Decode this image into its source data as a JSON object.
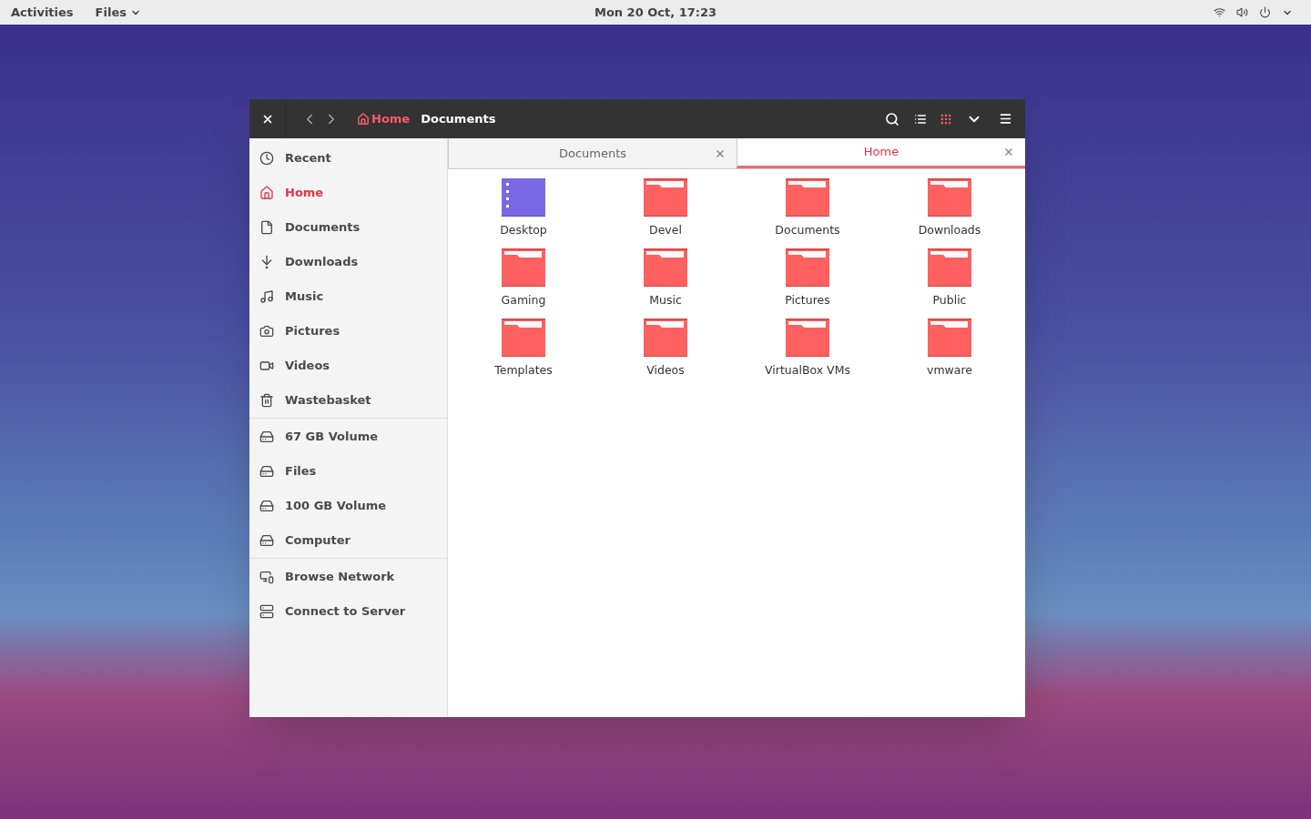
{
  "top_bar": {
    "activities": "Activities",
    "app_menu": "Files",
    "clock": "Mon 20 Oct, 17:23"
  },
  "window": {
    "breadcrumbs": [
      {
        "label": "Home",
        "selected": true,
        "kind": "home"
      },
      {
        "label": "Documents",
        "selected": false,
        "kind": "folder"
      }
    ],
    "views": [
      {
        "kind": "list",
        "selected": false
      },
      {
        "kind": "grid",
        "selected": true
      }
    ]
  },
  "sidebar": {
    "sections": [
      [
        {
          "label": "Recent",
          "selected": false
        },
        {
          "label": "Home",
          "selected": true
        },
        {
          "label": "Documents",
          "selected": false
        },
        {
          "label": "Downloads",
          "selected": false
        },
        {
          "label": "Music",
          "selected": false
        },
        {
          "label": "Pictures",
          "selected": false
        },
        {
          "label": "Videos",
          "selected": false
        },
        {
          "label": "Wastebasket",
          "selected": false
        }
      ],
      [
        {
          "label": "67 GB Volume",
          "selected": false
        },
        {
          "label": "Files",
          "selected": false
        },
        {
          "label": "100 GB Volume",
          "selected": false
        },
        {
          "label": "Computer",
          "selected": false
        }
      ],
      [
        {
          "label": "Browse Network",
          "selected": false
        },
        {
          "label": "Connect to Server",
          "selected": false
        }
      ]
    ]
  },
  "tabs": [
    {
      "label": "Documents",
      "selected": false
    },
    {
      "label": "Home",
      "selected": true
    }
  ],
  "files": [
    {
      "name": "Desktop",
      "kind": "desktop"
    },
    {
      "name": "Devel",
      "kind": "folder"
    },
    {
      "name": "Documents",
      "kind": "folder"
    },
    {
      "name": "Downloads",
      "kind": "folder"
    },
    {
      "name": "Gaming",
      "kind": "folder"
    },
    {
      "name": "Music",
      "kind": "folder"
    },
    {
      "name": "Pictures",
      "kind": "folder"
    },
    {
      "name": "Public",
      "kind": "folder"
    },
    {
      "name": "Templates",
      "kind": "folder"
    },
    {
      "name": "Videos",
      "kind": "folder"
    },
    {
      "name": "VirtualBox VMs",
      "kind": "folder"
    },
    {
      "name": "vmware",
      "kind": "folder"
    }
  ]
}
